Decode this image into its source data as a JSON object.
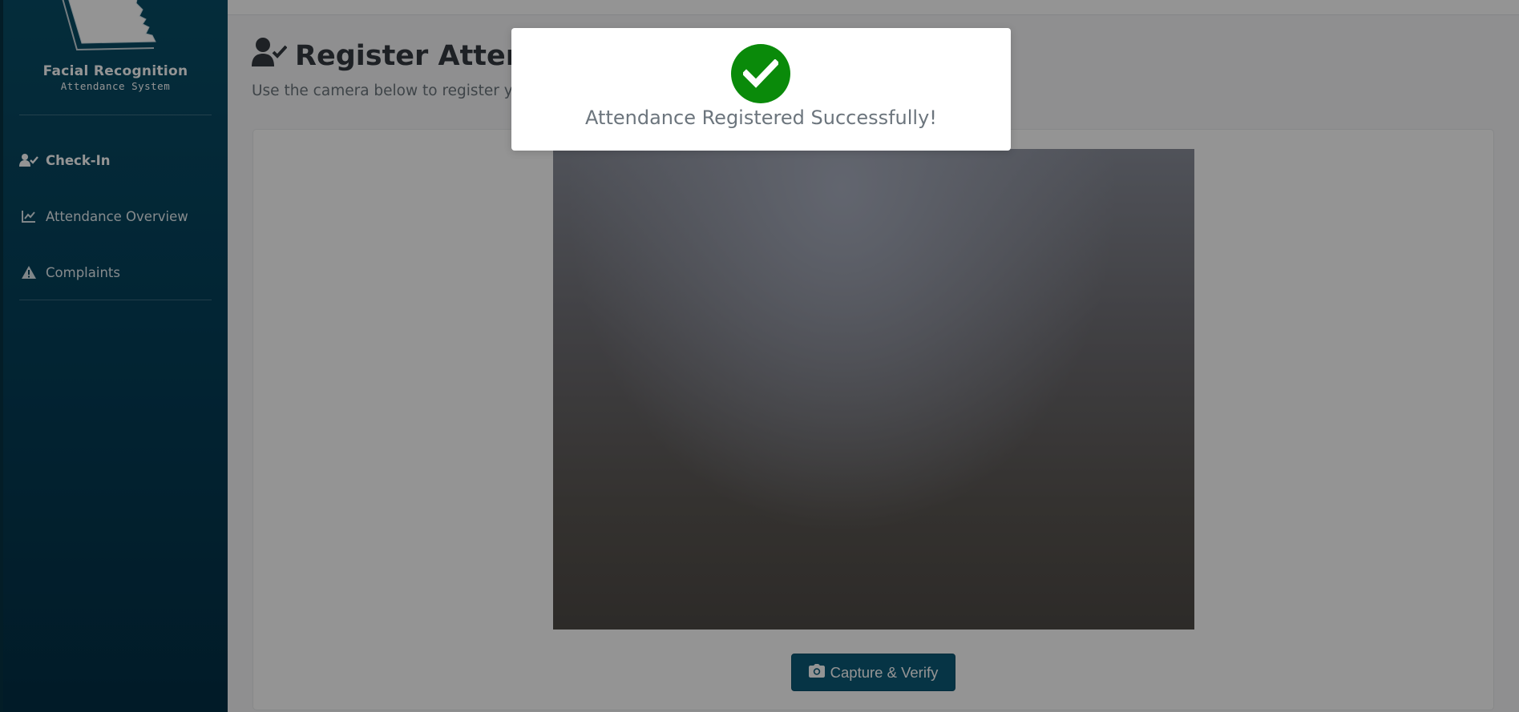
{
  "sidebar": {
    "logo_title": "Facial Recognition",
    "logo_subtitle": "Attendance System",
    "items": [
      {
        "label": "Check-In",
        "icon": "user-check-icon",
        "active": true
      },
      {
        "label": "Attendance Overview",
        "icon": "chart-line-icon",
        "active": false
      },
      {
        "label": "Complaints",
        "icon": "warning-triangle-icon",
        "active": false
      }
    ]
  },
  "main": {
    "title": "Register Attendance",
    "title_icon": "user-check-icon",
    "subtitle": "Use the camera below to register yo",
    "capture_button": {
      "label": "Capture & Verify",
      "icon": "camera-icon"
    }
  },
  "modal": {
    "message": "Attendance Registered Successfully!",
    "icon": "check-circle-icon"
  },
  "colors": {
    "sidebar_bg": "#05405a",
    "primary_button": "#0b5a78",
    "success": "#0a8a0a"
  }
}
